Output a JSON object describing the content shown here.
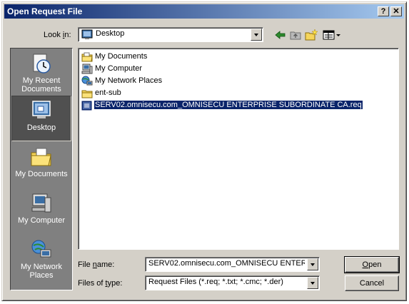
{
  "window": {
    "title": "Open Request File",
    "help_label": "?",
    "close_label": "✕"
  },
  "lookin": {
    "label_pre": "Look ",
    "label_u": "i",
    "label_post": "n:",
    "value": "Desktop",
    "icon": "desktop-icon"
  },
  "toolbar": [
    "back-arrow-icon",
    "up-folder-icon",
    "new-folder-icon",
    "view-menu-icon"
  ],
  "places": [
    {
      "label": "My Recent Documents",
      "icon": "recent-documents-icon",
      "selected": false
    },
    {
      "label": "Desktop",
      "icon": "desktop-icon",
      "selected": true
    },
    {
      "label": "My Documents",
      "icon": "my-documents-icon",
      "selected": false
    },
    {
      "label": "My Computer",
      "icon": "my-computer-icon",
      "selected": false
    },
    {
      "label": "My Network Places",
      "icon": "network-places-icon",
      "selected": false
    }
  ],
  "files": [
    {
      "name": "My Documents",
      "icon": "folder-docs-icon"
    },
    {
      "name": "My Computer",
      "icon": "computer-icon"
    },
    {
      "name": "My Network Places",
      "icon": "network-icon"
    },
    {
      "name": "ent-sub",
      "icon": "folder-icon"
    },
    {
      "name": "SERV02.omnisecu.com_OMNISECU ENTERPRISE SUBORDINATE CA.req",
      "icon": "req-file-icon",
      "selected": true
    }
  ],
  "filename": {
    "label_pre": "File ",
    "label_u": "n",
    "label_post": "ame:",
    "value": "SERV02.omnisecu.com_OMNISECU ENTERP"
  },
  "filetype": {
    "label_pre": "Files of ",
    "label_u": "t",
    "label_post": "ype:",
    "value": "Request Files (*.req; *.txt; *.cmc; *.der)"
  },
  "buttons": {
    "open_u": "O",
    "open_rest": "pen",
    "cancel": "Cancel"
  },
  "colors": {
    "titlebar_start": "#0a246a",
    "titlebar_end": "#a6caf0",
    "selection": "#0a246a",
    "face": "#d4d0c8"
  }
}
